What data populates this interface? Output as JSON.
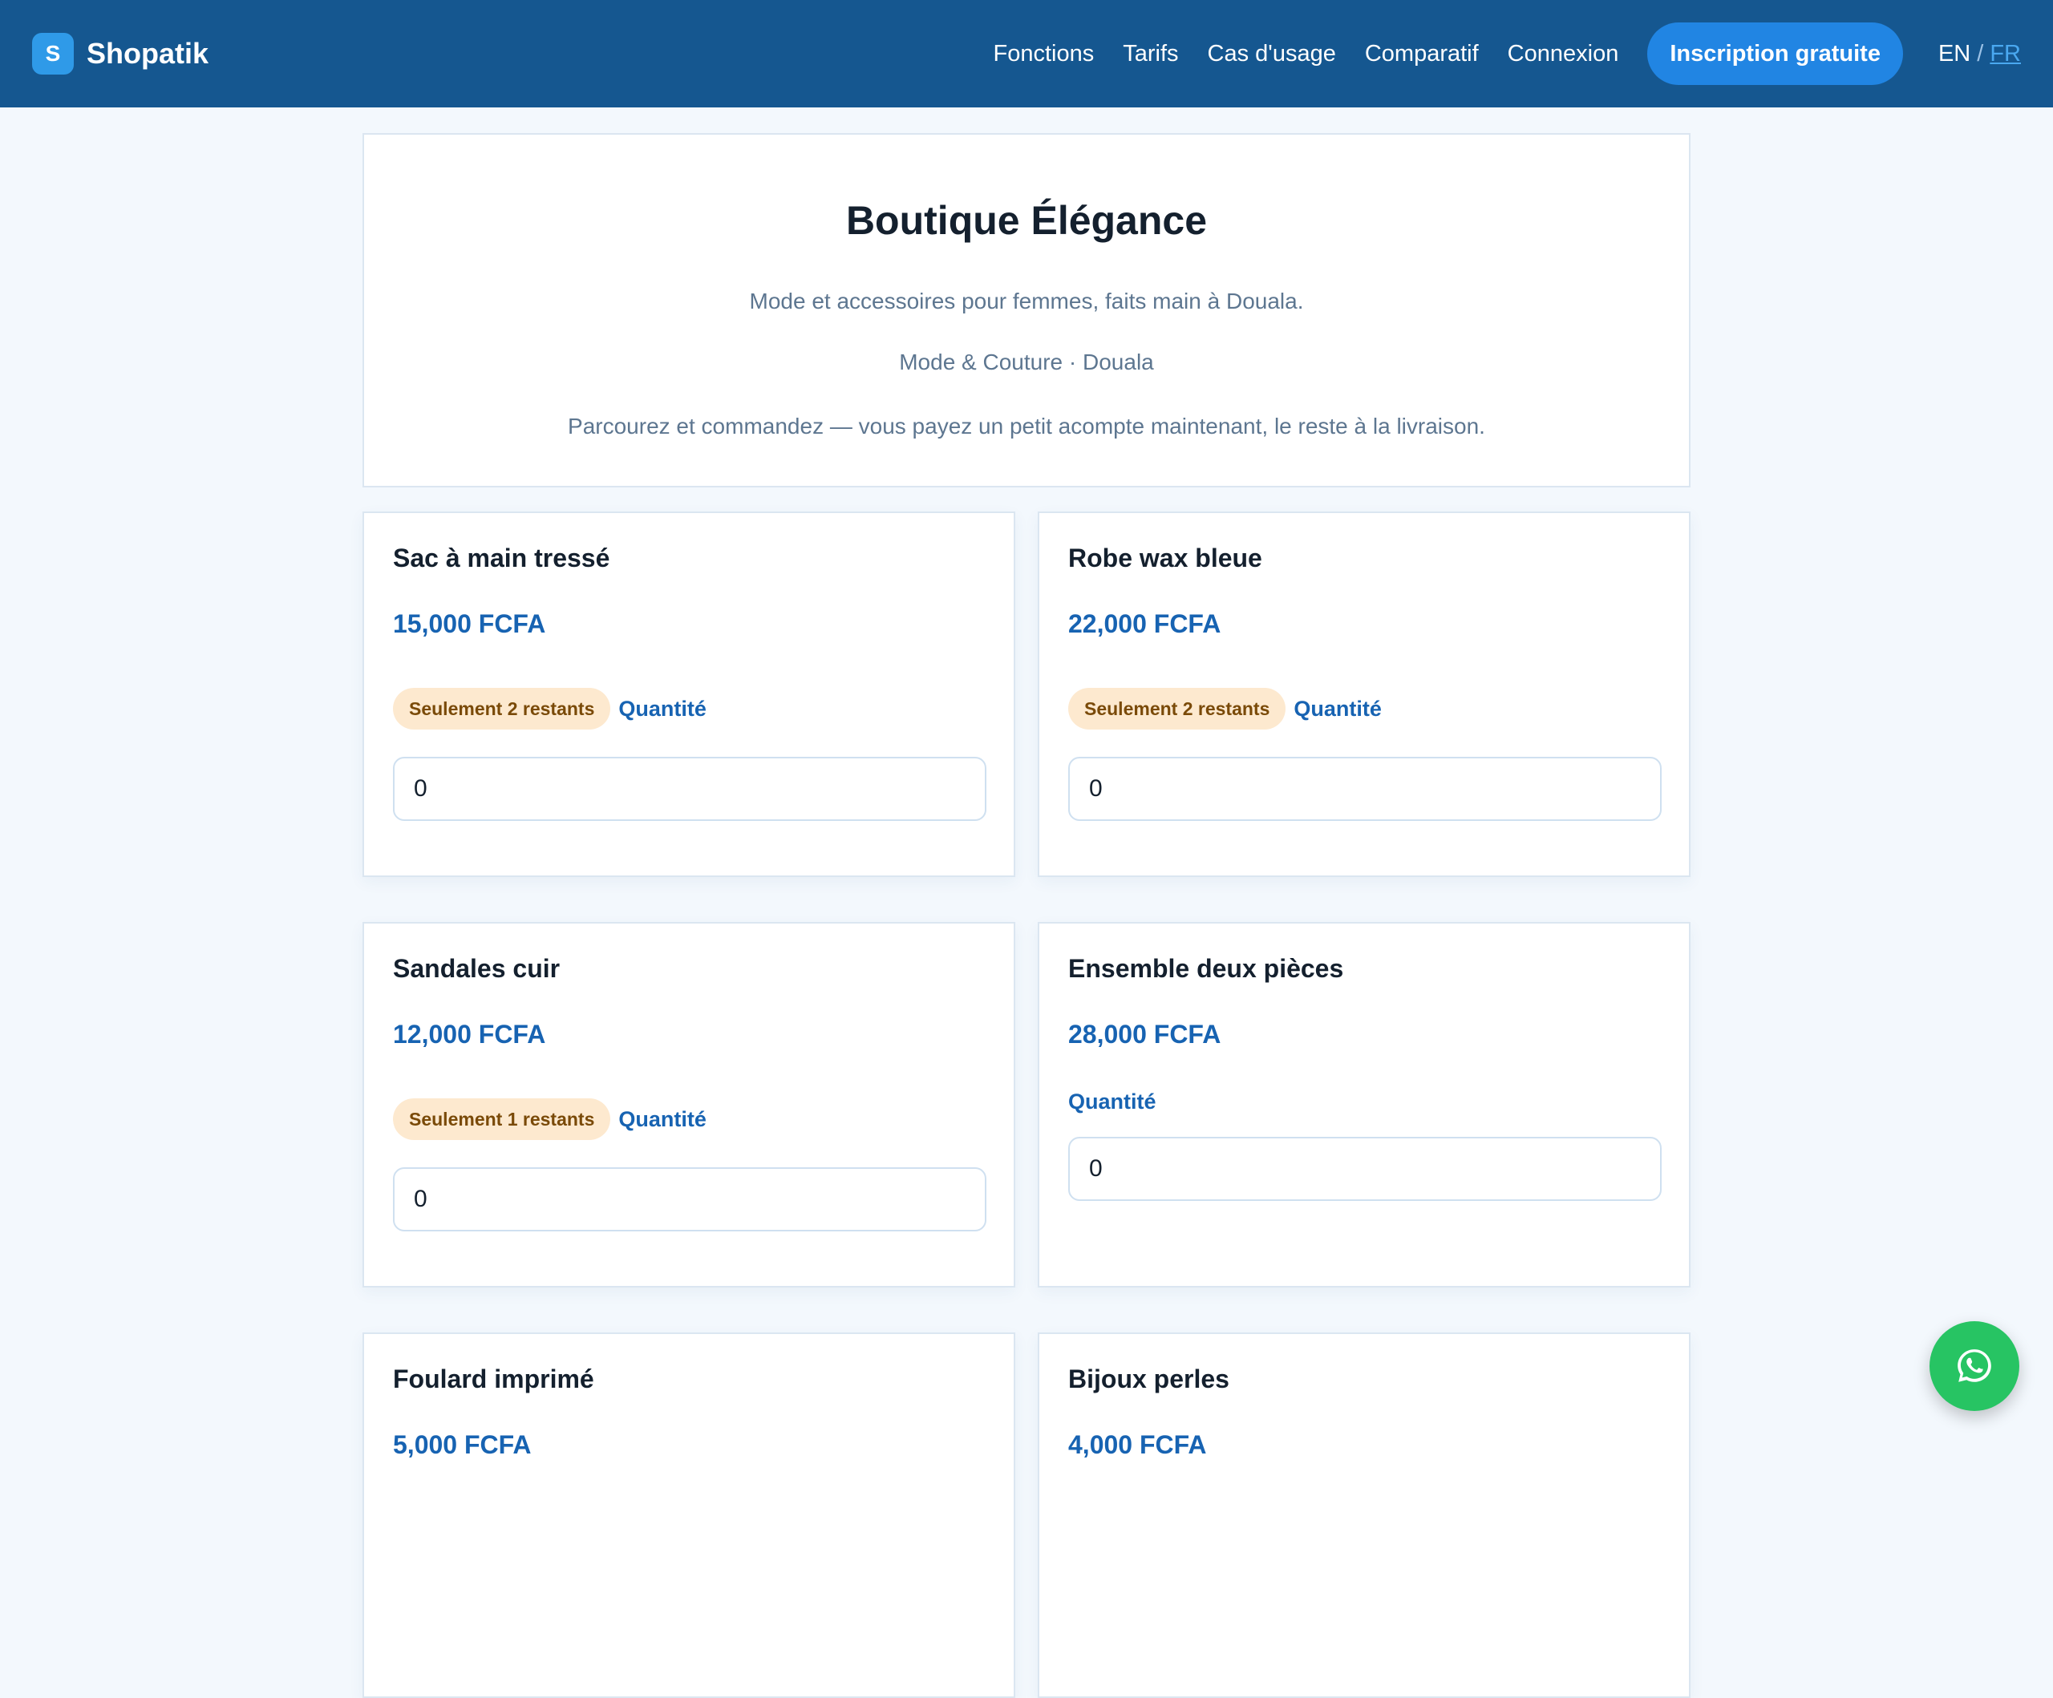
{
  "header": {
    "logo_letter": "S",
    "brand": "Shopatik",
    "nav": [
      "Fonctions",
      "Tarifs",
      "Cas d'usage",
      "Comparatif",
      "Connexion"
    ],
    "cta": "Inscription gratuite",
    "lang_en": "EN",
    "lang_sep": "/",
    "lang_fr": "FR"
  },
  "shop": {
    "title": "Boutique Élégance",
    "description": "Mode et accessoires pour femmes, faits main à Douala.",
    "category": "Mode & Couture · Douala",
    "note": "Parcourez et commandez — vous payez un petit acompte maintenant, le reste à la livraison."
  },
  "products": [
    {
      "name": "Sac à main tressé",
      "price": "15,000 FCFA",
      "badge": "Seulement 2 restants",
      "qty_label": "Quantité",
      "qty": "0"
    },
    {
      "name": "Robe wax bleue",
      "price": "22,000 FCFA",
      "badge": "Seulement 2 restants",
      "qty_label": "Quantité",
      "qty": "0"
    },
    {
      "name": "Sandales cuir",
      "price": "12,000 FCFA",
      "badge": "Seulement 1 restants",
      "qty_label": "Quantité",
      "qty": "0"
    },
    {
      "name": "Ensemble deux pièces",
      "price": "28,000 FCFA",
      "badge": "",
      "qty_label": "Quantité",
      "qty": "0"
    },
    {
      "name": "Foulard imprimé",
      "price": "5,000 FCFA"
    },
    {
      "name": "Bijoux perles",
      "price": "4,000 FCFA"
    }
  ],
  "icons": {
    "whatsapp": "whatsapp-icon"
  },
  "colors": {
    "header_bg": "#155790",
    "cta_bg": "#2185e3",
    "price": "#1763b2",
    "badge_bg": "#fde9cf",
    "badge_text": "#7a4a08",
    "whatsapp": "#27c463"
  }
}
